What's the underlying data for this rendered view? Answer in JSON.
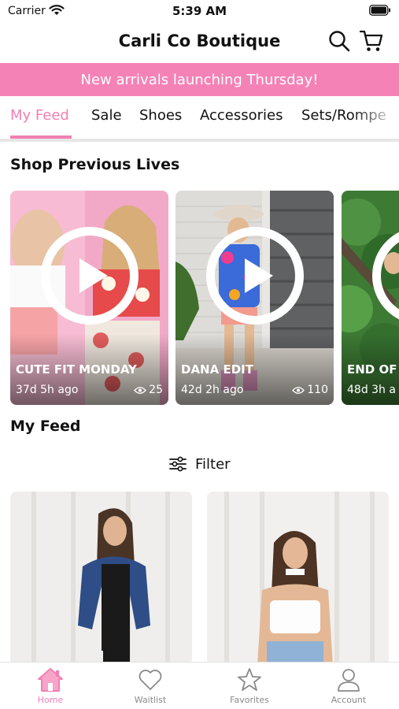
{
  "status_bar": {
    "carrier": "Carrier",
    "time": "5:39 AM"
  },
  "header": {
    "title": "Carli Co Boutique",
    "icons": [
      "search-icon",
      "cart-icon"
    ]
  },
  "banner": {
    "text": "New arrivals launching Thursday!",
    "color": "#f582b6"
  },
  "tabs": [
    {
      "label": "My Feed",
      "active": true
    },
    {
      "label": "Sale",
      "active": false
    },
    {
      "label": "Shoes",
      "active": false
    },
    {
      "label": "Accessories",
      "active": false
    },
    {
      "label": "Sets/Rompe",
      "active": false
    }
  ],
  "lives_section": {
    "title": "Shop Previous Lives",
    "items": [
      {
        "title": "CUTE FIT MONDAY",
        "time_ago": "37d 5h ago",
        "views": "25"
      },
      {
        "title": "DANA EDIT",
        "time_ago": "42d 2h ago",
        "views": "110"
      },
      {
        "title": "END OF",
        "time_ago": "48d 3h a",
        "views": ""
      }
    ]
  },
  "feed_section": {
    "title": "My Feed",
    "filter_label": "Filter"
  },
  "bottom_nav": [
    {
      "label": "Home",
      "icon": "home-icon",
      "active": true
    },
    {
      "label": "Waitlist",
      "icon": "heart-icon",
      "active": false
    },
    {
      "label": "Favorites",
      "icon": "star-icon",
      "active": false
    },
    {
      "label": "Account",
      "icon": "account-icon",
      "active": false
    }
  ],
  "colors": {
    "accent": "#f27fb3",
    "banner": "#f582b6",
    "inactive_nav": "#8a8a8a"
  }
}
